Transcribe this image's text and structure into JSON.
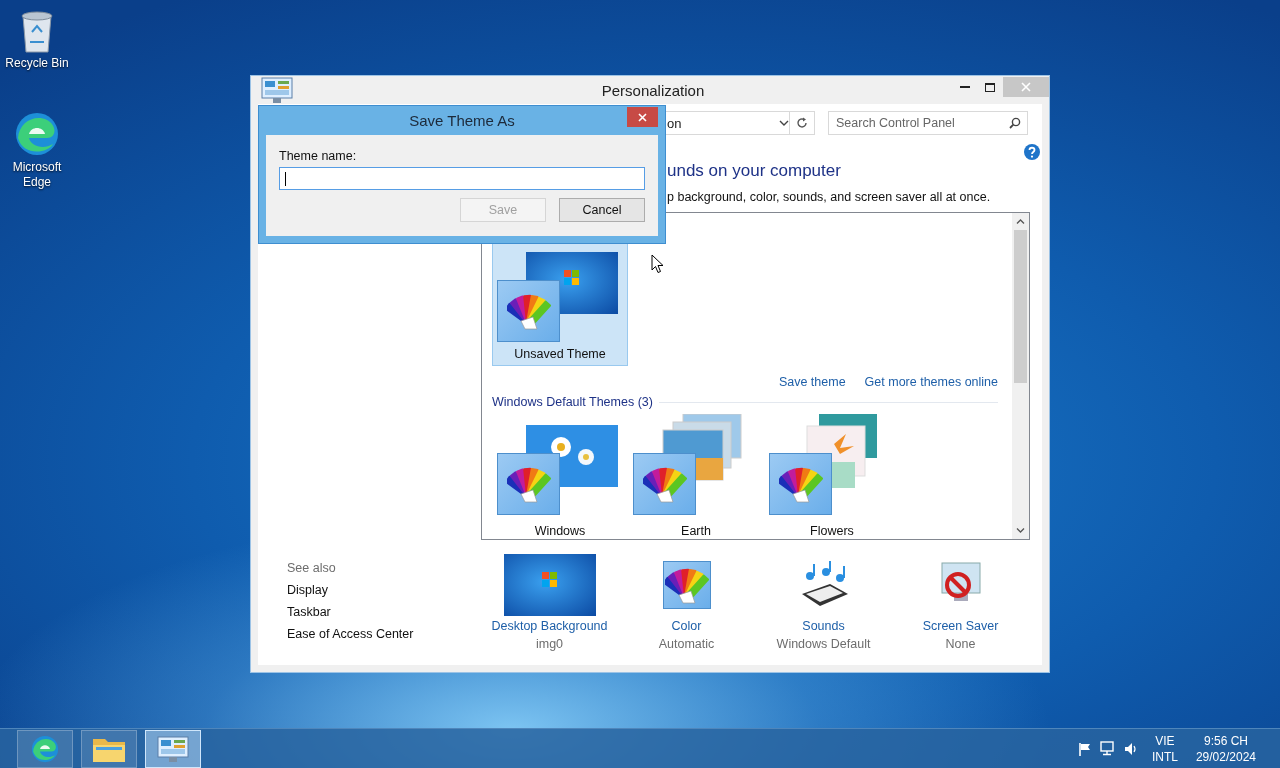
{
  "desktop_icons": [
    {
      "kind": "recycle_bin",
      "label": "Recycle Bin"
    },
    {
      "kind": "edge",
      "label": "Microsoft Edge"
    }
  ],
  "window": {
    "title": "Personalization",
    "address": "on",
    "search": {
      "placeholder": "Search Control Panel"
    },
    "heading": "unds on your computer",
    "description": "p background, color, sounds, and screen saver all at once.",
    "my_themes": [
      {
        "label": "Unsaved Theme",
        "kind": "single",
        "selected": true
      }
    ],
    "links": [
      "Save theme",
      "Get more themes online"
    ],
    "default_group": {
      "title": "Windows Default Themes (3)",
      "themes": [
        {
          "label": "Windows",
          "kind": "daisies",
          "selected": false
        },
        {
          "label": "Earth",
          "kind": "earth",
          "selected": false
        },
        {
          "label": "Flowers",
          "kind": "flowers",
          "selected": false
        }
      ]
    },
    "see_also": {
      "title": "See also",
      "links": [
        "Display",
        "Taskbar",
        "Ease of Access Center"
      ]
    },
    "settings": [
      {
        "kind": "background",
        "label": "Desktop Background",
        "value": "img0"
      },
      {
        "kind": "color",
        "label": "Color",
        "value": "Automatic"
      },
      {
        "kind": "sounds",
        "label": "Sounds",
        "value": "Windows Default"
      },
      {
        "kind": "screensaver",
        "label": "Screen Saver",
        "value": "None"
      }
    ]
  },
  "dialog": {
    "title": "Save Theme As",
    "field_label": "Theme name:",
    "focused": true,
    "buttons": [
      {
        "label": "Save",
        "disabled": true
      },
      {
        "label": "Cancel",
        "disabled": false
      }
    ]
  },
  "taskbar": {
    "apps": [
      {
        "kind": "edge",
        "active": false
      },
      {
        "kind": "explorer",
        "active": false
      },
      {
        "kind": "control_panel",
        "active": true
      }
    ],
    "language": [
      "VIE",
      "INTL"
    ],
    "time": "9:56 CH",
    "date": "29/02/2024"
  }
}
